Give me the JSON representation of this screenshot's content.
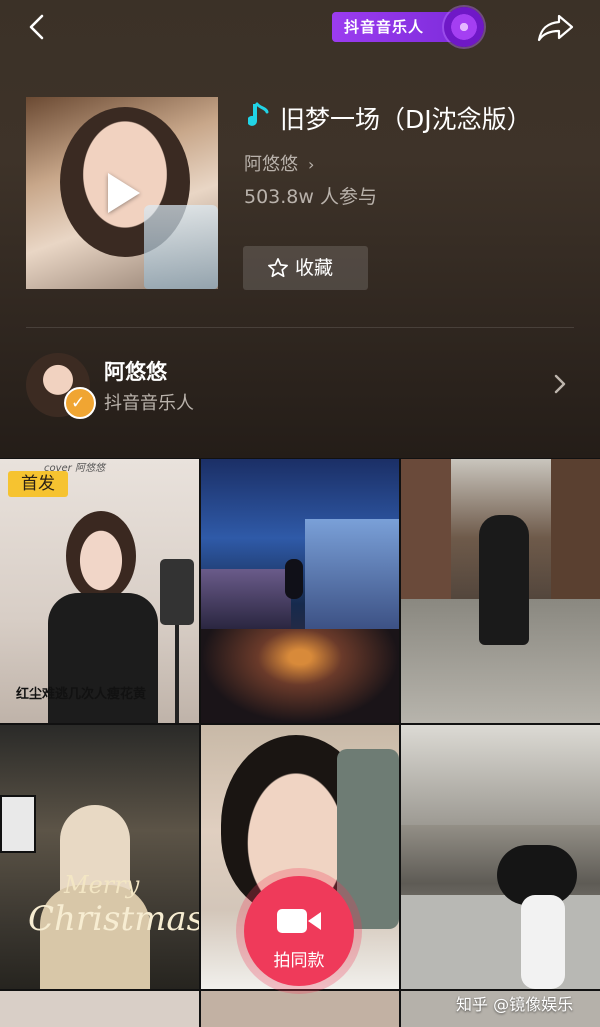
{
  "header": {
    "brand_label": "抖音音乐人",
    "song_title": "旧梦一场（DJ沈念版）",
    "artist": "阿悠悠",
    "participants": "503.8w 人参与",
    "favorite_label": "收藏"
  },
  "creator": {
    "name": "阿悠悠",
    "role": "抖音音乐人"
  },
  "videos": [
    {
      "badge": "首发",
      "caption_top": "cover 阿悠悠",
      "caption": "红尘难逃几次人瘦花黄"
    },
    {
      "badge": "",
      "caption": ""
    },
    {
      "badge": "",
      "caption": ""
    },
    {
      "badge": "",
      "caption": "",
      "overlay_line1": "Merry",
      "overlay_line2": "Christmas"
    },
    {
      "badge": "",
      "caption": ""
    },
    {
      "badge": "",
      "caption": ""
    }
  ],
  "shoot_button": {
    "label": "拍同款"
  },
  "watermark": "知乎 @镜像娱乐",
  "colors": {
    "accent_red": "#ef3a5a",
    "brand_purple": "#9b3cf0",
    "badge_yellow": "#f6c330",
    "verify_orange": "#f0a532",
    "note_cyan": "#21d4e6"
  },
  "icons": {
    "back": "back-chevron-icon",
    "share": "share-icon",
    "note": "music-note-icon",
    "star": "star-icon",
    "play": "play-icon",
    "camera": "camera-icon",
    "verify": "verified-check-icon"
  }
}
